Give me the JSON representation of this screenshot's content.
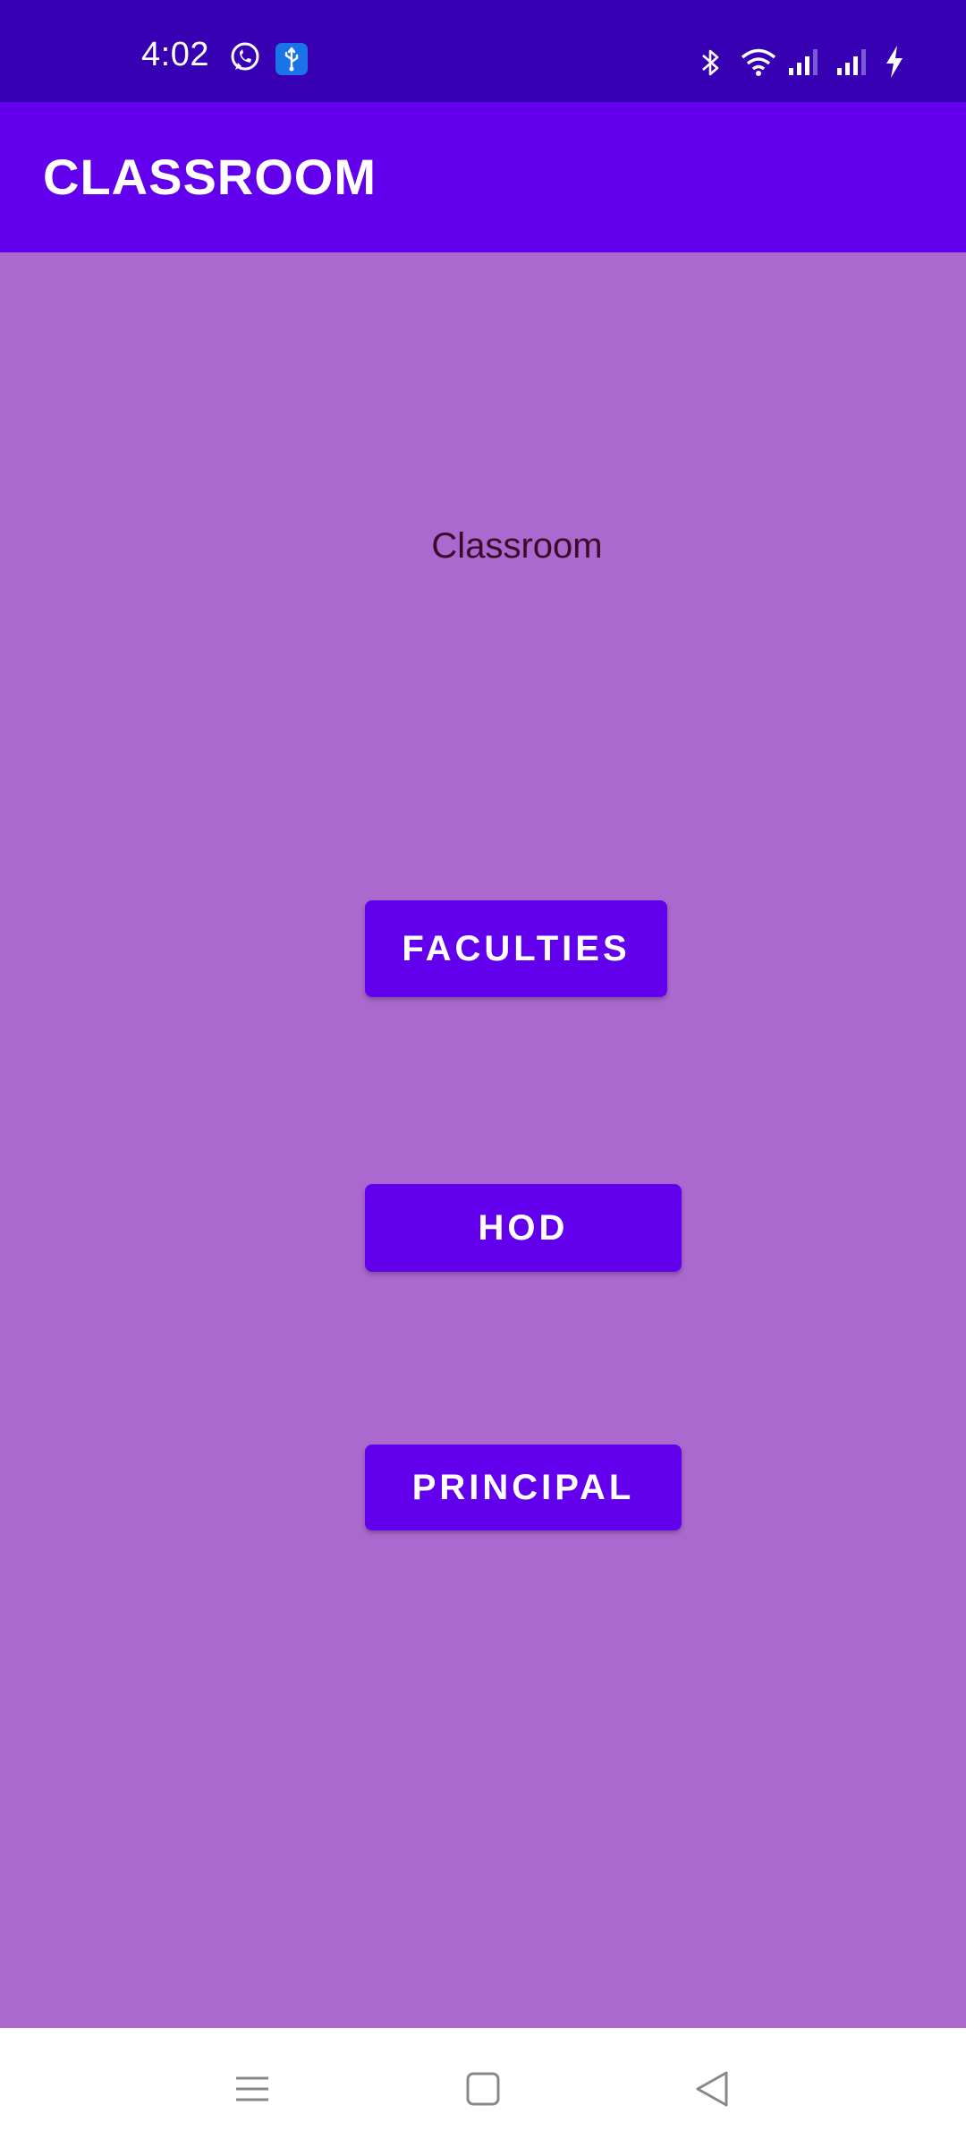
{
  "status_bar": {
    "time": "4:02",
    "left_icons": [
      "whatsapp-icon",
      "usb-icon"
    ],
    "right_icons": [
      "bluetooth-icon",
      "wifi-icon",
      "signal-icon",
      "signal-icon",
      "charging-icon"
    ]
  },
  "app_bar": {
    "title": "CLASSROOM"
  },
  "main": {
    "heading": "Classroom",
    "buttons": {
      "faculties": "FACULTIES",
      "hod": "HOD",
      "principal": "PRINCIPAL"
    }
  },
  "nav_bar": {
    "icons": [
      "menu-icon",
      "home-icon",
      "back-icon"
    ]
  },
  "colors": {
    "status_bar": "#3700b3",
    "app_bar": "#6200ee",
    "background": "#ab68cf",
    "button": "#6200ee"
  }
}
